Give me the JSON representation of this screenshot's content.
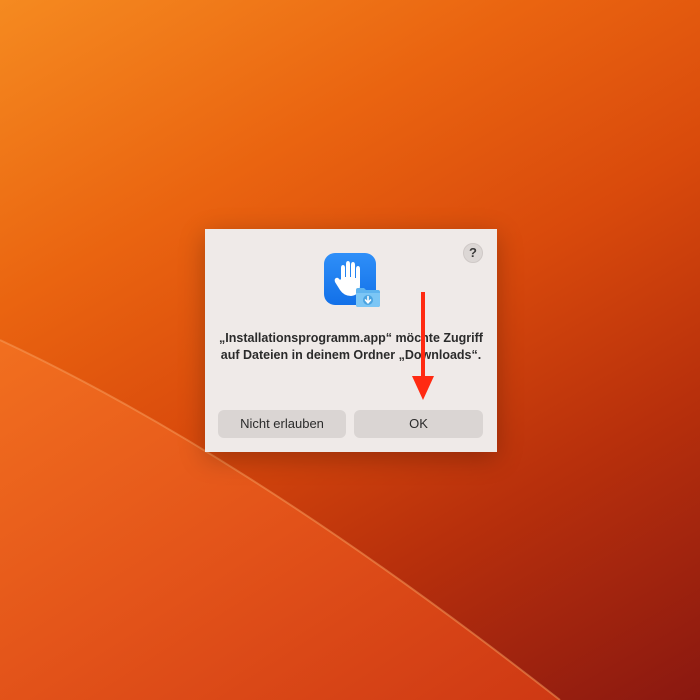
{
  "dialog": {
    "help_label": "?",
    "app_icon": "hand-stop-icon",
    "badge_icon": "downloads-folder-icon",
    "message": "„Installationsprogramm.app“ möchte Zugriff auf Dateien in deinem Ordner „Downloads“.",
    "deny_label": "Nicht erlauben",
    "ok_label": "OK"
  },
  "annotation": {
    "icon": "red-arrow-down-icon",
    "color": "#ff2a12"
  },
  "colors": {
    "wallpaper_light": "#f58a20",
    "wallpaper_dark": "#8a1810",
    "dialog_bg": "#efeae8",
    "icon_blue": "#1f80f0"
  }
}
